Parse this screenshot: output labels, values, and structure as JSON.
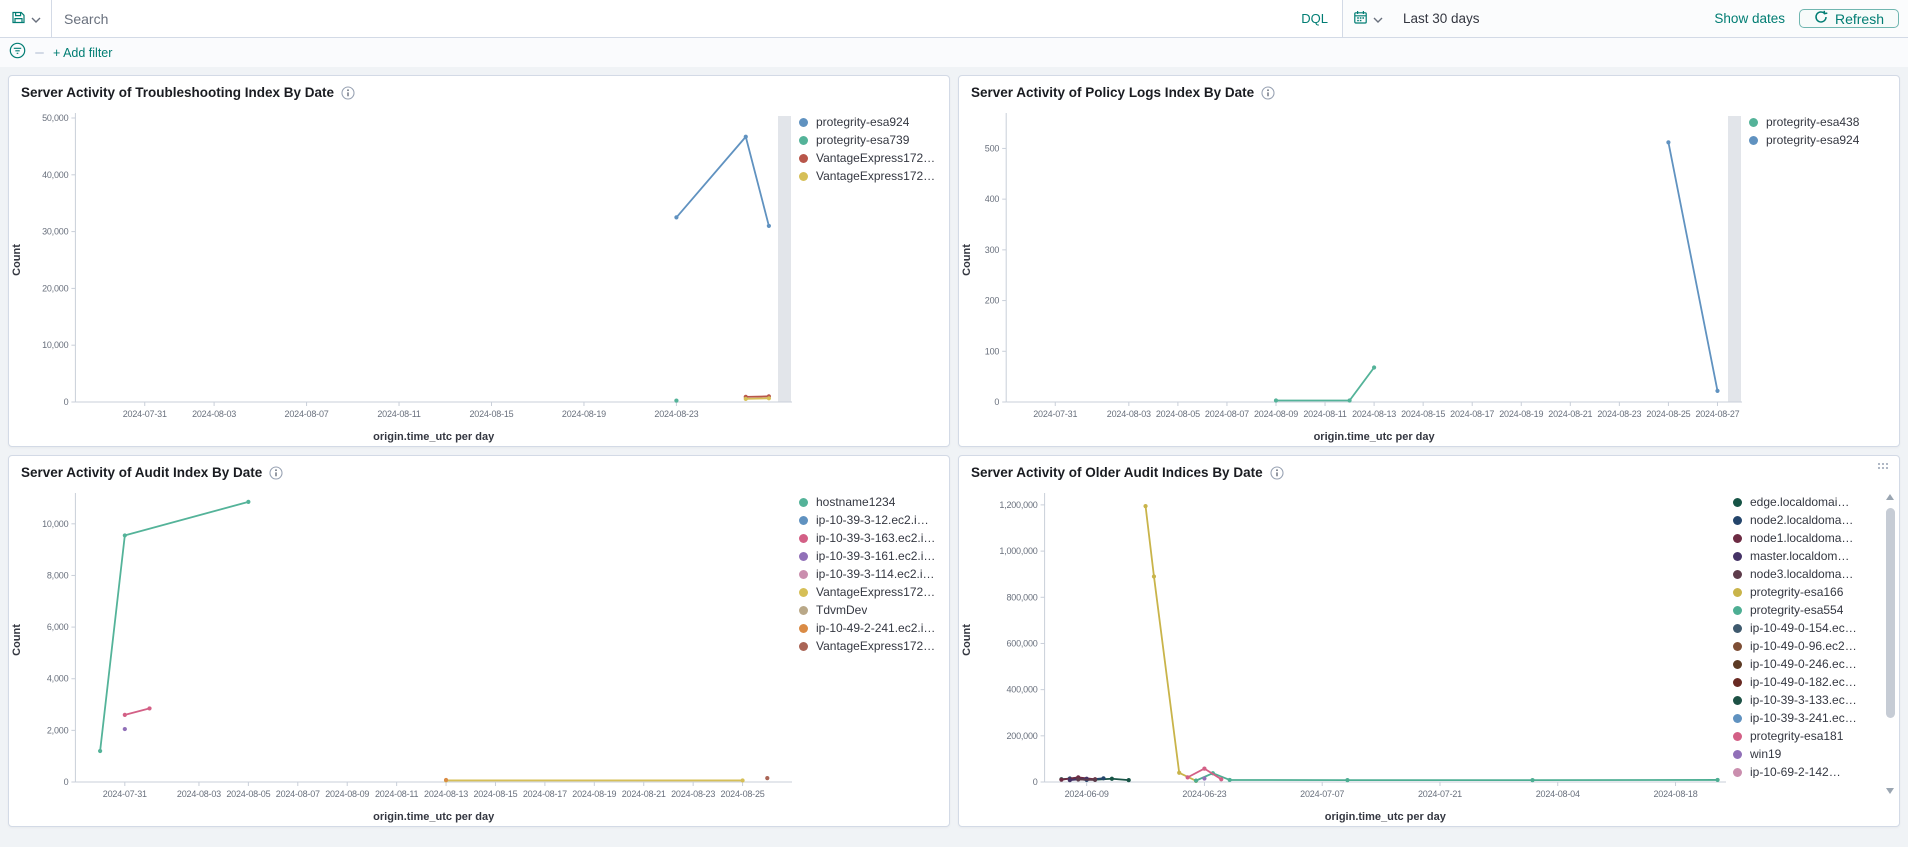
{
  "accent_color": "#017d73",
  "top_bar": {
    "search_placeholder": "Search",
    "query_language_label": "DQL",
    "time_range": "Last 30 days",
    "show_dates_label": "Show dates",
    "refresh_label": "Refresh"
  },
  "filter_bar": {
    "add_filter_label": "+ Add filter"
  },
  "panels": [
    {
      "title": "Server Activity of Troubleshooting Index By Date",
      "chart_data": {
        "type": "line",
        "xlabel": "origin.time_utc per day",
        "ylabel": "Count",
        "grid": false,
        "legend_position": "right",
        "x_domain": [
          "2024-07-28",
          "2024-08-28"
        ],
        "ylim": [
          0,
          50000
        ],
        "y_ticks": [
          0,
          10000,
          20000,
          30000,
          40000,
          50000
        ],
        "x_ticks": [
          "2024-07-31",
          "2024-08-03",
          "2024-08-07",
          "2024-08-11",
          "2024-08-15",
          "2024-08-19",
          "2024-08-23"
        ],
        "partial_bucket_bar": true,
        "series": [
          {
            "name": "protegrity-esa924",
            "color": "#6092C0",
            "points": [
              [
                "2024-08-23",
                32500
              ],
              [
                "2024-08-26",
                46700
              ],
              [
                "2024-08-27",
                31000
              ]
            ]
          },
          {
            "name": "protegrity-esa739",
            "color": "#54B399",
            "points": [
              [
                "2024-08-23",
                250
              ]
            ]
          },
          {
            "name": "VantageExpress172…",
            "color": "#B8564A",
            "points": [
              [
                "2024-08-26",
                900
              ],
              [
                "2024-08-27",
                1000
              ]
            ]
          },
          {
            "name": "VantageExpress172…",
            "color": "#D6BF57",
            "points": [
              [
                "2024-08-26",
                550
              ],
              [
                "2024-08-27",
                650
              ]
            ]
          }
        ]
      }
    },
    {
      "title": "Server Activity of Policy Logs Index By Date",
      "chart_data": {
        "type": "line",
        "xlabel": "origin.time_utc per day",
        "ylabel": "Count",
        "grid": false,
        "legend_position": "right",
        "x_domain": [
          "2024-07-29",
          "2024-08-28"
        ],
        "ylim": [
          0,
          560
        ],
        "y_ticks": [
          0,
          100,
          200,
          300,
          400,
          500
        ],
        "x_ticks": [
          "2024-07-31",
          "2024-08-03",
          "2024-08-05",
          "2024-08-07",
          "2024-08-09",
          "2024-08-11",
          "2024-08-13",
          "2024-08-15",
          "2024-08-17",
          "2024-08-19",
          "2024-08-21",
          "2024-08-23",
          "2024-08-25",
          "2024-08-27"
        ],
        "partial_bucket_bar": true,
        "series": [
          {
            "name": "protegrity-esa438",
            "color": "#54B399",
            "points": [
              [
                "2024-08-09",
                3
              ],
              [
                "2024-08-12",
                3
              ],
              [
                "2024-08-13",
                68
              ]
            ]
          },
          {
            "name": "protegrity-esa924",
            "color": "#6092C0",
            "points": [
              [
                "2024-08-25",
                512
              ],
              [
                "2024-08-27",
                22
              ]
            ]
          }
        ]
      }
    },
    {
      "title": "Server Activity of Audit Index By Date",
      "chart_data": {
        "type": "line",
        "xlabel": "origin.time_utc per day",
        "ylabel": "Count",
        "grid": false,
        "legend_position": "right",
        "x_domain": [
          "2024-07-29",
          "2024-08-27"
        ],
        "ylim": [
          0,
          11000
        ],
        "y_ticks": [
          0,
          2000,
          4000,
          6000,
          8000,
          10000
        ],
        "x_ticks": [
          "2024-07-31",
          "2024-08-03",
          "2024-08-05",
          "2024-08-07",
          "2024-08-09",
          "2024-08-11",
          "2024-08-13",
          "2024-08-15",
          "2024-08-17",
          "2024-08-19",
          "2024-08-21",
          "2024-08-23",
          "2024-08-25"
        ],
        "partial_bucket_bar": false,
        "series": [
          {
            "name": "hostname1234",
            "color": "#54B399",
            "points": [
              [
                "2024-07-30",
                1200
              ],
              [
                "2024-07-31",
                9550
              ],
              [
                "2024-08-05",
                10850
              ]
            ]
          },
          {
            "name": "ip-10-39-3-12.ec2.i…",
            "color": "#6092C0",
            "points": []
          },
          {
            "name": "ip-10-39-3-163.ec2.i…",
            "color": "#D36086",
            "points": [
              [
                "2024-07-31",
                2600
              ],
              [
                "2024-08-01",
                2850
              ]
            ]
          },
          {
            "name": "ip-10-39-3-161.ec2.i…",
            "color": "#9170B8",
            "points": [
              [
                "2024-07-31",
                2050
              ]
            ]
          },
          {
            "name": "ip-10-39-3-114.ec2.i…",
            "color": "#CA8EAE",
            "points": []
          },
          {
            "name": "VantageExpress172…",
            "color": "#D6BF57",
            "points": [
              [
                "2024-08-13",
                60
              ],
              [
                "2024-08-25",
                60
              ]
            ]
          },
          {
            "name": "TdvmDev",
            "color": "#B9A888",
            "points": []
          },
          {
            "name": "ip-10-49-2-241.ec2.i…",
            "color": "#DA8B45",
            "points": [
              [
                "2024-08-13",
                80
              ]
            ]
          },
          {
            "name": "VantageExpress172…",
            "color": "#AA6556",
            "points": [
              [
                "2024-08-26",
                150
              ]
            ]
          }
        ]
      }
    },
    {
      "title": "Server Activity of Older Audit Indices By Date",
      "chart_data": {
        "type": "line",
        "xlabel": "origin.time_utc per day",
        "ylabel": "Count",
        "grid": false,
        "legend_position": "right",
        "legend_scrollbar": true,
        "x_domain": [
          "2024-06-04",
          "2024-08-24"
        ],
        "ylim": [
          0,
          1230000
        ],
        "y_ticks": [
          0,
          200000,
          400000,
          600000,
          800000,
          1000000,
          1200000
        ],
        "x_ticks": [
          "2024-06-09",
          "2024-06-23",
          "2024-07-07",
          "2024-07-21",
          "2024-08-04",
          "2024-08-18"
        ],
        "partial_bucket_bar": false,
        "series": [
          {
            "name": "edge.localdomai…",
            "color": "#175446",
            "points": [
              [
                "2024-06-06",
                12000
              ],
              [
                "2024-06-08",
                18000
              ],
              [
                "2024-06-10",
                10000
              ],
              [
                "2024-06-12",
                14000
              ],
              [
                "2024-06-14",
                8000
              ]
            ]
          },
          {
            "name": "node2.localdoma…",
            "color": "#24456B",
            "points": [
              [
                "2024-06-07",
                15000
              ],
              [
                "2024-06-09",
                9000
              ],
              [
                "2024-06-11",
                16000
              ]
            ]
          },
          {
            "name": "node1.localdoma…",
            "color": "#6D2B43",
            "points": [
              [
                "2024-06-06",
                10000
              ],
              [
                "2024-06-08",
                20000
              ],
              [
                "2024-06-10",
                12000
              ]
            ]
          },
          {
            "name": "master.localdom…",
            "color": "#453366",
            "points": [
              [
                "2024-06-07",
                8000
              ],
              [
                "2024-06-09",
                14000
              ]
            ]
          },
          {
            "name": "node3.localdoma…",
            "color": "#5E3C4B",
            "points": [
              [
                "2024-06-08",
                11000
              ],
              [
                "2024-06-10",
                9000
              ]
            ]
          },
          {
            "name": "protegrity-esa166",
            "color": "#C9B44A",
            "points": [
              [
                "2024-06-16",
                1195000
              ],
              [
                "2024-06-17",
                890000
              ],
              [
                "2024-06-20",
                40000
              ],
              [
                "2024-06-22",
                5000
              ]
            ]
          },
          {
            "name": "protegrity-esa554",
            "color": "#4DAE93",
            "points": [
              [
                "2024-06-22",
                6000
              ],
              [
                "2024-06-24",
                38000
              ],
              [
                "2024-06-26",
                9000
              ],
              [
                "2024-07-10",
                8000
              ],
              [
                "2024-08-01",
                8000
              ],
              [
                "2024-08-23",
                9000
              ]
            ]
          },
          {
            "name": "ip-10-49-0-154.ec…",
            "color": "#3F5A6E",
            "points": []
          },
          {
            "name": "ip-10-49-0-96.ec2…",
            "color": "#7E4E35",
            "points": []
          },
          {
            "name": "ip-10-49-0-246.ec…",
            "color": "#5C3A24",
            "points": []
          },
          {
            "name": "ip-10-49-0-182.ec…",
            "color": "#692A23",
            "points": []
          },
          {
            "name": "ip-10-39-3-133.ec…",
            "color": "#1D5145",
            "points": []
          },
          {
            "name": "ip-10-39-3-241.ec…",
            "color": "#6092C0",
            "points": []
          },
          {
            "name": "protegrity-esa181",
            "color": "#D36086",
            "points": [
              [
                "2024-06-21",
                20000
              ],
              [
                "2024-06-23",
                58000
              ],
              [
                "2024-06-25",
                12000
              ]
            ]
          },
          {
            "name": "win19",
            "color": "#9170B8",
            "points": [
              [
                "2024-06-23",
                15000
              ]
            ]
          },
          {
            "name": "ip-10-69-2-142…",
            "color": "#CA8EAE",
            "points": [],
            "clipped": true
          }
        ]
      }
    }
  ]
}
